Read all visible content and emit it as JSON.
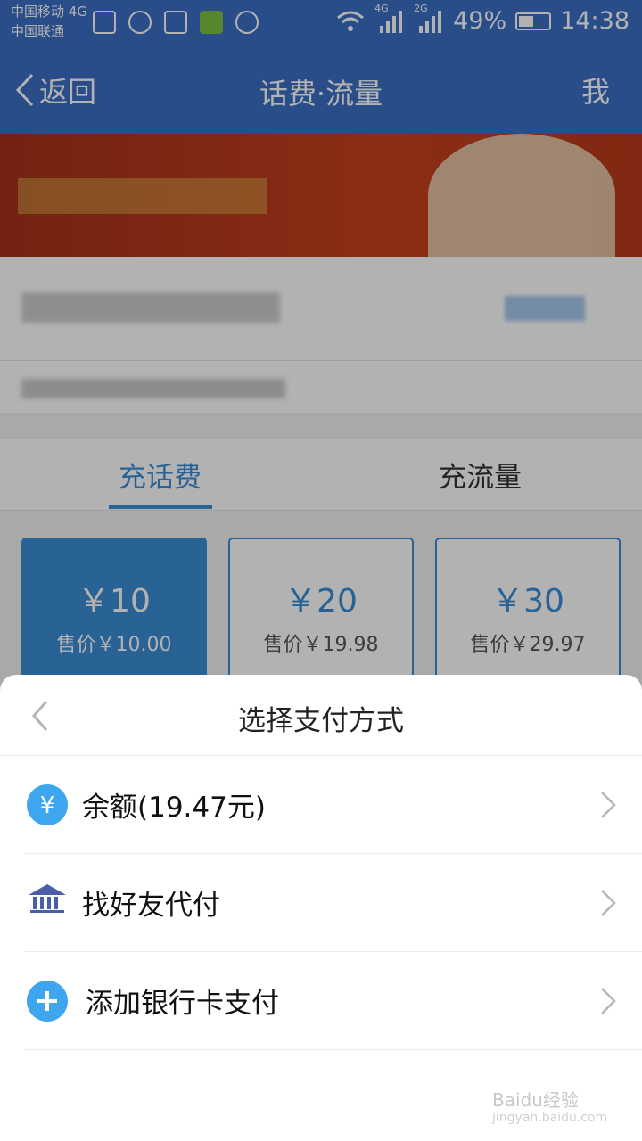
{
  "status_bar": {
    "carrier_1": "中国移动 4G",
    "carrier_2": "中国联通",
    "signal_4g": "4G",
    "signal_2g": "2G",
    "battery": "49%",
    "time": "14:38"
  },
  "nav": {
    "back_label": "返回",
    "title": "话费·流量",
    "me_label": "我"
  },
  "tabs": [
    {
      "label": "充话费",
      "active": true
    },
    {
      "label": "充流量",
      "active": false
    }
  ],
  "prices": [
    {
      "amount": "￥10",
      "sale": "售价￥10.00",
      "selected": true
    },
    {
      "amount": "￥20",
      "sale": "售价￥19.98",
      "selected": false
    },
    {
      "amount": "￥30",
      "sale": "售价￥29.97",
      "selected": false
    }
  ],
  "payment_sheet": {
    "title": "选择支付方式",
    "options": [
      {
        "label": "余额(19.47元)",
        "icon": "yuan-icon"
      },
      {
        "label": "找好友代付",
        "icon": "bank-icon"
      },
      {
        "label": "添加银行卡支付",
        "icon": "plus-icon"
      }
    ]
  },
  "watermark": {
    "brand": "Baidu经验",
    "url": "jingyan.baidu.com"
  },
  "colors": {
    "accent": "#3b8ed6",
    "navbar": "#3a6fc4"
  }
}
